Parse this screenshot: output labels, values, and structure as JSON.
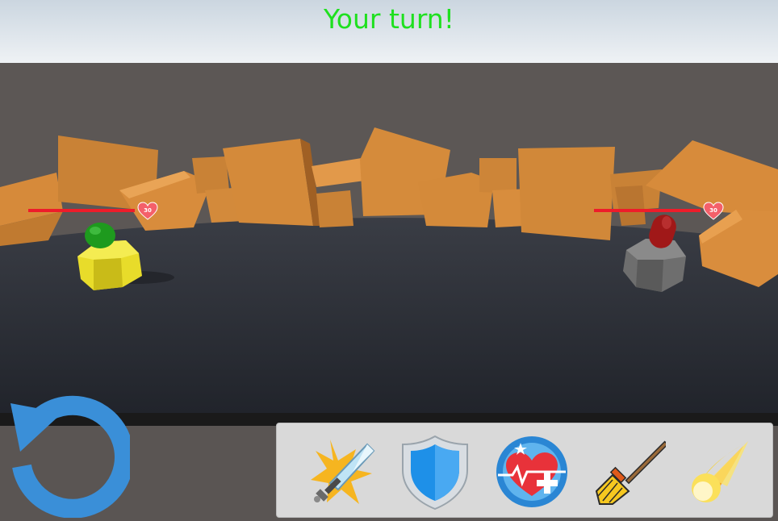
{
  "status": {
    "turn_text": "Your turn!",
    "turn_color": "#1fe01f"
  },
  "player": {
    "health": 30,
    "health_bar_color": "#ee1c2a",
    "body_color": "#e8dc2a",
    "head_color": "#1e9a1e"
  },
  "enemy": {
    "health": 30,
    "health_bar_color": "#ee1c2a",
    "body_color": "#6a6a6a",
    "head_color": "#a01818"
  },
  "controls": {
    "restart_icon": "restart-arrow-icon",
    "accent": "#3a8fd8"
  },
  "abilities": [
    {
      "name": "attack",
      "icon": "sword-icon"
    },
    {
      "name": "defend",
      "icon": "shield-icon"
    },
    {
      "name": "heal",
      "icon": "heart-heal-icon"
    },
    {
      "name": "sweep",
      "icon": "broom-icon"
    },
    {
      "name": "fireball",
      "icon": "fireball-icon"
    }
  ]
}
